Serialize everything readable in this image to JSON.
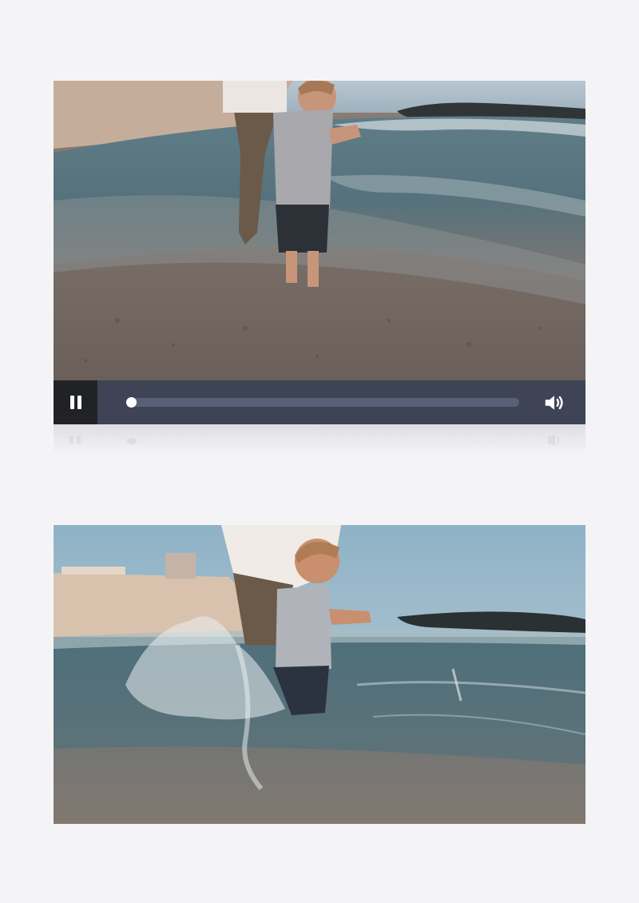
{
  "player": {
    "state": "playing",
    "progress": 0.0,
    "controls_color": "#3e4356",
    "track_color": "#5a5f78"
  },
  "icons": {
    "play_pause": "pause-icon",
    "volume": "volume-icon"
  }
}
